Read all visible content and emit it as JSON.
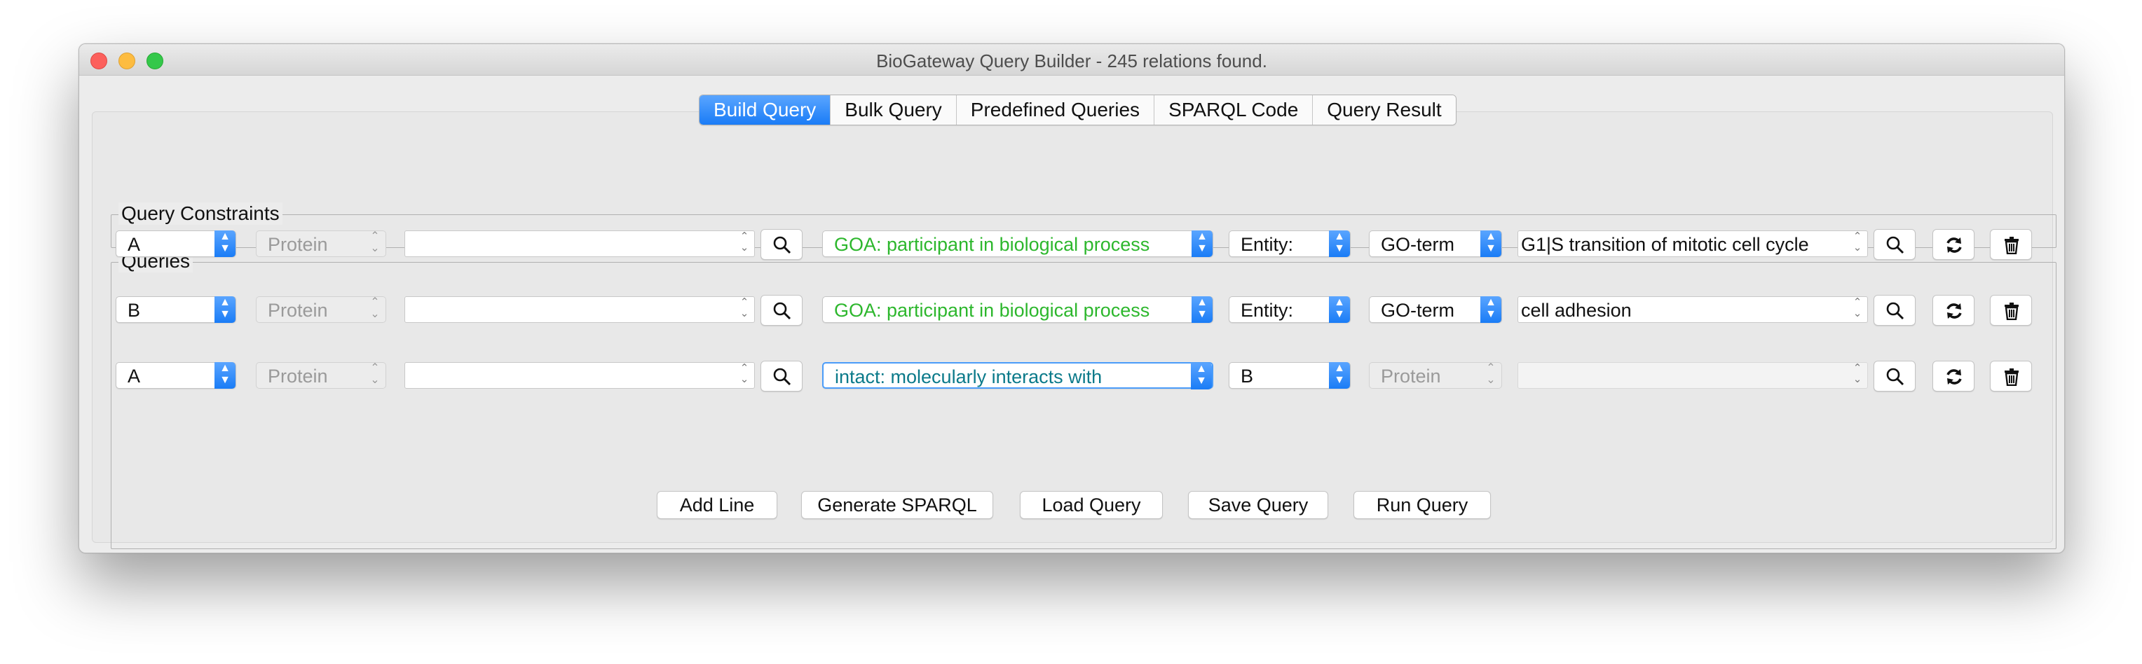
{
  "window": {
    "title": "BioGateway Query Builder - 245 relations found."
  },
  "tabs": [
    {
      "label": "Build Query",
      "active": true
    },
    {
      "label": "Bulk Query",
      "active": false
    },
    {
      "label": "Predefined Queries",
      "active": false
    },
    {
      "label": "SPARQL Code",
      "active": false
    },
    {
      "label": "Query Result",
      "active": false
    }
  ],
  "groups": {
    "constraints_label": "Query Constraints",
    "queries_label": "Queries"
  },
  "rows": [
    {
      "subject_var": "A",
      "subject_type": "Protein",
      "subject_value": "",
      "relation": "GOA: participant in biological process",
      "relation_color": "#2db72d",
      "object_var": "Entity:",
      "object_type": "GO-term",
      "object_value": "G1|S transition of mitotic cell cycle"
    },
    {
      "subject_var": "B",
      "subject_type": "Protein",
      "subject_value": "",
      "relation": "GOA: participant in biological process",
      "relation_color": "#2db72d",
      "object_var": "Entity:",
      "object_type": "GO-term",
      "object_value": "cell adhesion"
    },
    {
      "subject_var": "A",
      "subject_type": "Protein",
      "subject_value": "",
      "relation": "intact: molecularly interacts with",
      "relation_color": "#0b7a8a",
      "object_var": "B",
      "object_type": "Protein",
      "object_value": ""
    }
  ],
  "buttons": {
    "add_line": "Add Line",
    "generate_sparql": "Generate SPARQL",
    "load_query": "Load Query",
    "save_query": "Save Query",
    "run_query": "Run Query"
  },
  "icons": {
    "search": "search-icon",
    "refresh": "refresh-icon",
    "delete": "trash-icon"
  },
  "colors": {
    "accent": "#1a7cf6"
  }
}
